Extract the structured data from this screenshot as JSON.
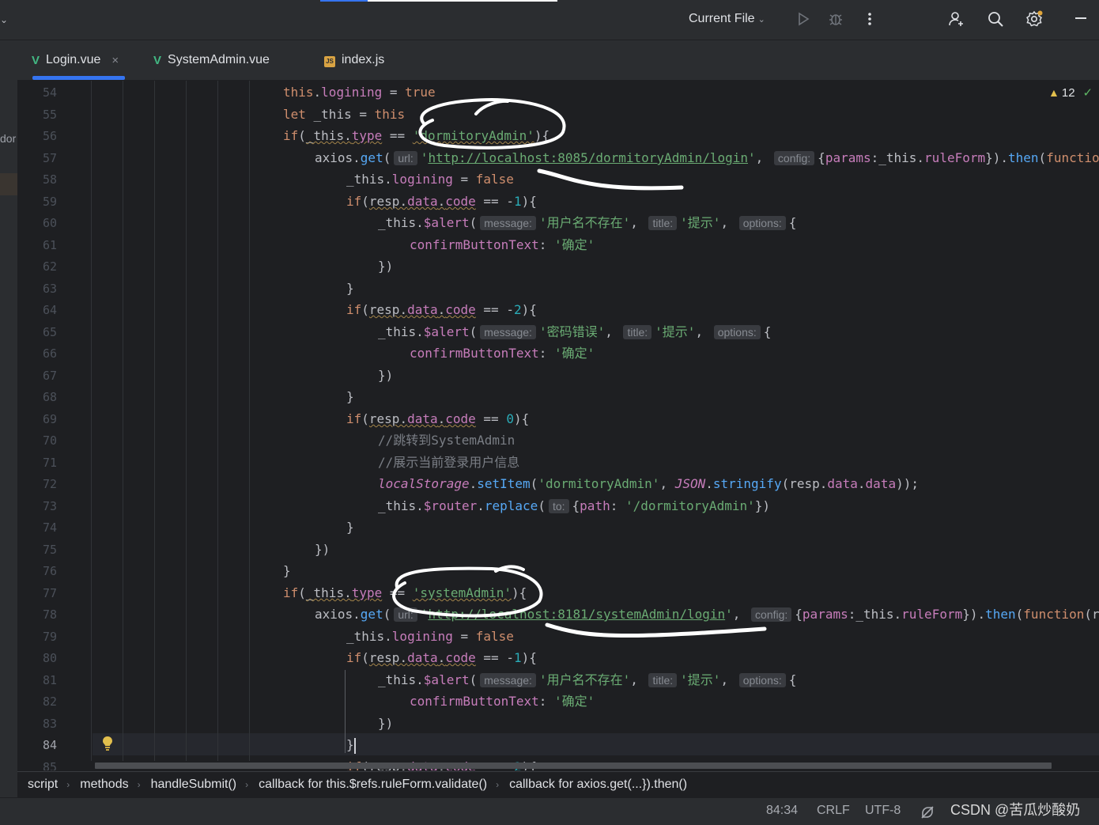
{
  "toolbar": {
    "run_config_label": "Current File",
    "icons": [
      "chevron-down-icon",
      "run-icon",
      "debug-icon",
      "more-vertical-icon",
      "add-user-icon",
      "search-icon",
      "settings-icon",
      "minimize-icon"
    ]
  },
  "left_strip": {
    "fragment_text": "dor"
  },
  "tabs": [
    {
      "label": "Login.vue",
      "icon": "vue-icon",
      "active": true
    },
    {
      "label": "SystemAdmin.vue",
      "icon": "vue-icon",
      "active": false
    },
    {
      "label": "index.js",
      "icon": "js-icon",
      "active": false
    }
  ],
  "editor": {
    "line_numbers": [
      "54",
      "55",
      "56",
      "57",
      "58",
      "59",
      "60",
      "61",
      "62",
      "63",
      "64",
      "65",
      "66",
      "67",
      "68",
      "69",
      "70",
      "71",
      "72",
      "73",
      "74",
      "75",
      "76",
      "77",
      "78",
      "79",
      "80",
      "81",
      "82",
      "83",
      "84",
      "85"
    ],
    "current_line": "84",
    "warnings_count": "12",
    "hints": {
      "url": "url:",
      "config": "config:",
      "message": "message:",
      "title": "title:",
      "options": "options:",
      "to": "to:"
    },
    "strings": {
      "dormitoryAdmin": "'dormitoryAdmin'",
      "systemAdmin": "'systemAdmin'",
      "url_dormitory": "http://localhost:8085/dormitoryAdmin/login",
      "url_system": "http://localhost:8181/systemAdmin/login",
      "user_not_exist": "'用户名不存在'",
      "tip": "'提示'",
      "confirm": "'确定'",
      "wrong_password": "'密码错误'",
      "comment_jump": "//跳转到SystemAdmin",
      "comment_show": "//展示当前登录用户信息",
      "storage_key": "'dormitoryAdmin'",
      "route_path": "'/dormitoryAdmin'"
    }
  },
  "breadcrumb": [
    "script",
    "methods",
    "handleSubmit()",
    "callback for this.$refs.ruleForm.validate()",
    "callback for axios.get(...}).then()"
  ],
  "status": {
    "position": "84:34",
    "line_ending": "CRLF",
    "encoding": "UTF-8",
    "watermark": "CSDN @苦瓜炒酸奶"
  },
  "colors": {
    "accent": "#3574f0",
    "keyword": "#cf8e6d",
    "string": "#6aab73",
    "number": "#2aacb8",
    "function": "#56a8f5",
    "property": "#c77dbb",
    "warning": "#e2bf4d"
  }
}
